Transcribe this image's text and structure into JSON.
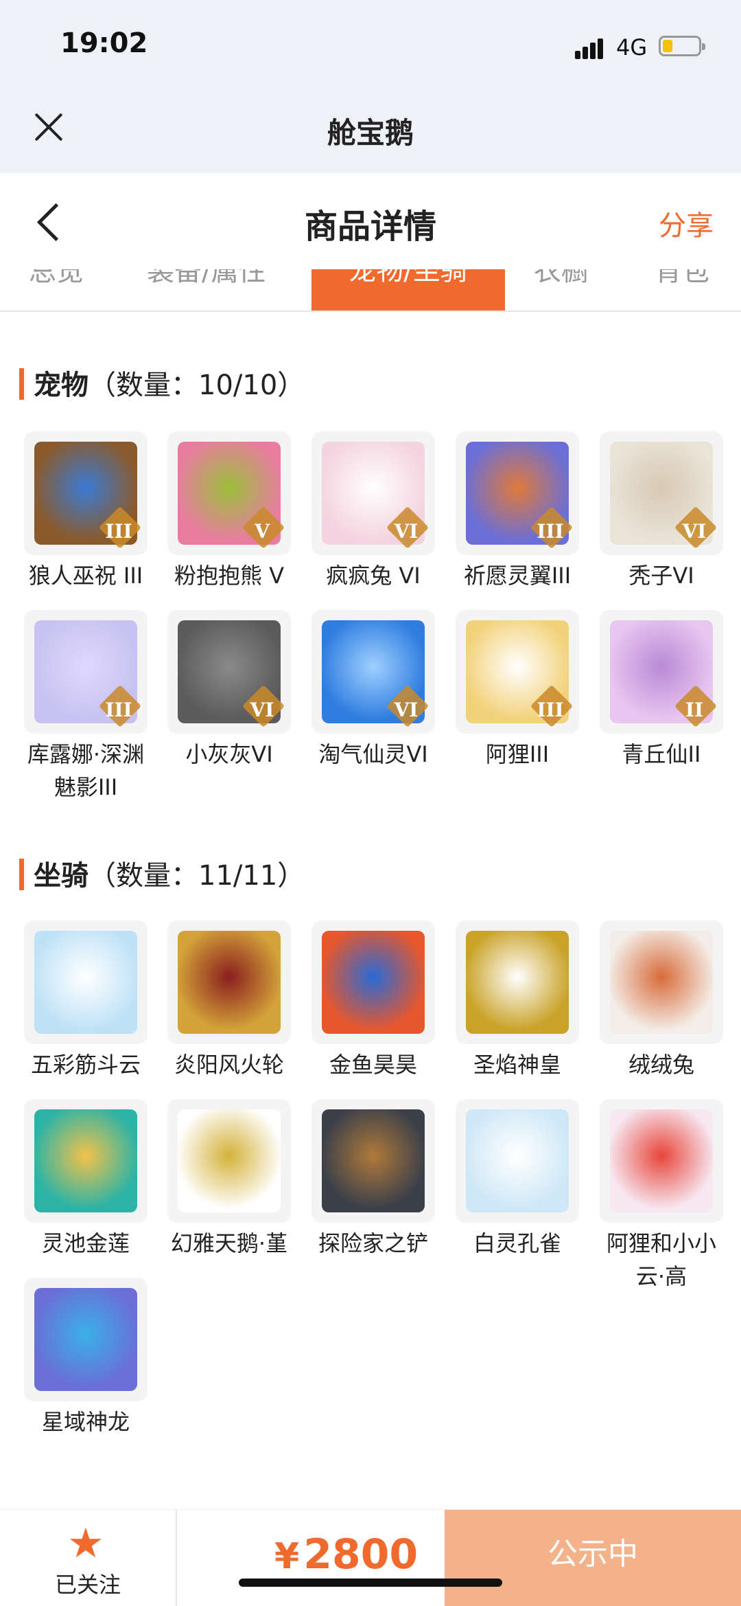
{
  "status_bar": {
    "time": "19:02",
    "network": "4G"
  },
  "app": {
    "title": "舱宝鹅"
  },
  "header": {
    "title": "商品详情",
    "share": "分享"
  },
  "tabs": [
    "总览",
    "装备/属性",
    "宠物/坐骑",
    "衣橱",
    "背包"
  ],
  "pets": {
    "title": "宠物",
    "count": "（数量：10/10）",
    "items": [
      {
        "name": "狼人巫祝 III",
        "grade": "III"
      },
      {
        "name": "粉抱抱熊 V",
        "grade": "V"
      },
      {
        "name": "疯疯兔 VI",
        "grade": "VI"
      },
      {
        "name": "祈愿灵翼III",
        "grade": "III"
      },
      {
        "name": "秃子VI",
        "grade": "VI"
      },
      {
        "name": "库露娜·深渊魅影III",
        "grade": "III"
      },
      {
        "name": "小灰灰VI",
        "grade": "VI"
      },
      {
        "name": "淘气仙灵VI",
        "grade": "VI"
      },
      {
        "name": "阿狸III",
        "grade": "III"
      },
      {
        "name": "青丘仙II",
        "grade": "II"
      }
    ]
  },
  "mounts": {
    "title": "坐骑",
    "count": "（数量：11/11）",
    "items": [
      {
        "name": "五彩筋斗云"
      },
      {
        "name": "炎阳风火轮"
      },
      {
        "name": "金鱼昊昊"
      },
      {
        "name": "圣焰神皇"
      },
      {
        "name": "绒绒兔"
      },
      {
        "name": "灵池金莲"
      },
      {
        "name": "幻雅天鹅·堇"
      },
      {
        "name": "探险家之铲"
      },
      {
        "name": "白灵孔雀"
      },
      {
        "name": "阿狸和小小云·高"
      },
      {
        "name": "星域神龙"
      }
    ]
  },
  "bottom_bar": {
    "follow_label": "已关注",
    "currency": "¥",
    "price": "2800",
    "status_button": "公示中"
  },
  "colors": {
    "accent": "#f06a2d",
    "status_button": "#f3b287"
  }
}
